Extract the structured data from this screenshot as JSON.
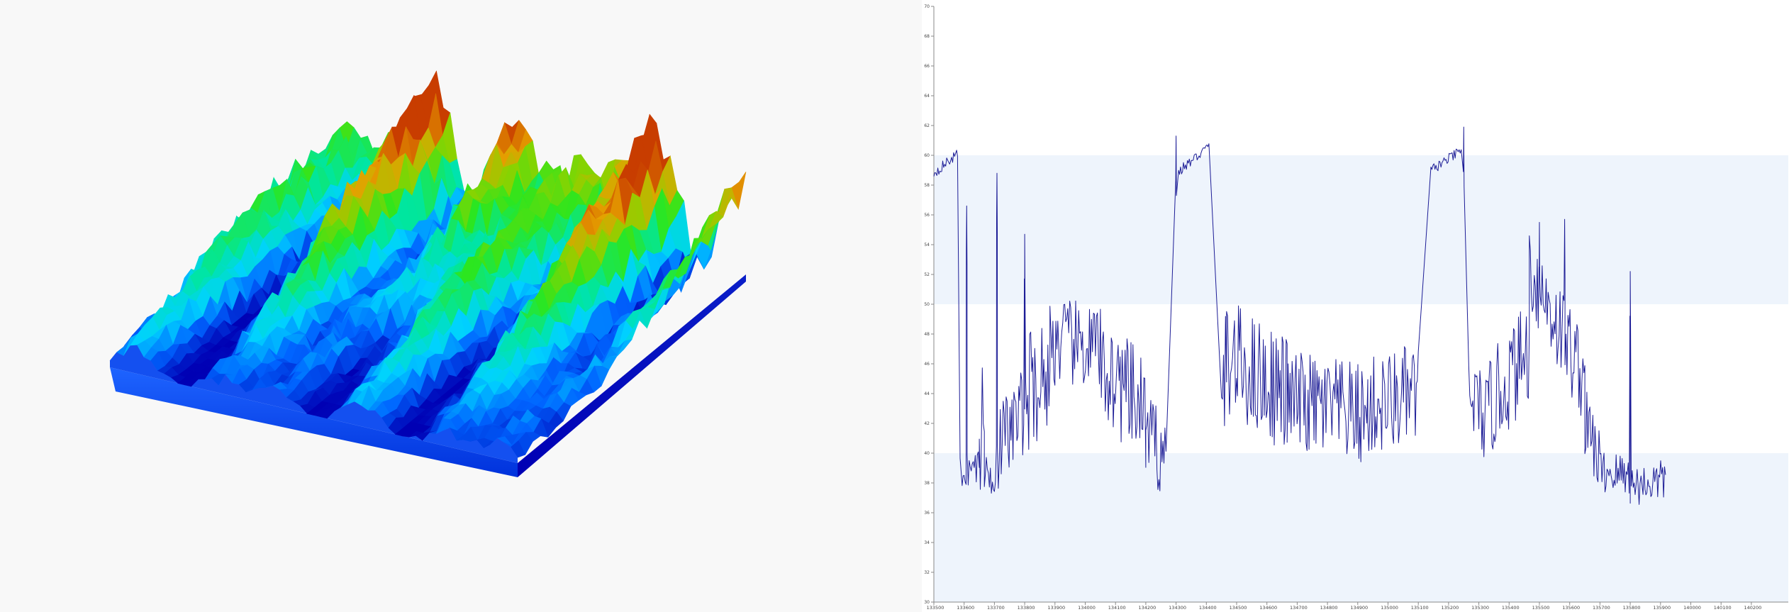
{
  "chart_data": [
    {
      "type": "surface",
      "colormap": [
        "#0000b4",
        "#0064ff",
        "#00d2ff",
        "#00e6a0",
        "#2ce61e",
        "#8cd200",
        "#e6a000",
        "#c83c00"
      ]
    },
    {
      "type": "line",
      "x_tick_labels": [
        "133500",
        "133600",
        "133700",
        "133800",
        "133900",
        "134000",
        "134100",
        "134200",
        "134300",
        "134400",
        "134500",
        "134600",
        "134700",
        "134800",
        "134900",
        "135000",
        "135100",
        "135200",
        "135300",
        "135400",
        "135500",
        "135600",
        "135700",
        "135800",
        "135900",
        "140000",
        "140100",
        "140200"
      ],
      "y_tick_labels": [
        "30",
        "32",
        "34",
        "36",
        "38",
        "40",
        "42",
        "44",
        "46",
        "48",
        "50",
        "52",
        "54",
        "56",
        "58",
        "60",
        "62",
        "64",
        "66",
        "68",
        "70"
      ],
      "ylim": [
        30,
        70
      ],
      "bands": [
        [
          30,
          40
        ],
        [
          50,
          60
        ]
      ],
      "band_color": "#eef4fc",
      "line_color": "#1c1c96",
      "segments": [
        {
          "x": [
            133500,
            133547
          ],
          "y": [
            58.8,
            60.1
          ],
          "noise": 0.35
        },
        {
          "x": [
            133552,
            133590
          ],
          "y": [
            38.7,
            39.2
          ],
          "noise": 1.2
        },
        {
          "x": [
            133590,
            133640
          ],
          "y": [
            40.0,
            44.0
          ],
          "noise": 3.5
        },
        {
          "x": [
            133640,
            133700
          ],
          "y": [
            38.5,
            38.5
          ],
          "noise": 1.5
        },
        {
          "x": [
            133700,
            133760
          ],
          "y": [
            40.0,
            43.0
          ],
          "noise": 3.0
        },
        {
          "x": [
            133760,
            133850
          ],
          "y": [
            44.0,
            45.5
          ],
          "noise": 4.0
        },
        {
          "x": [
            133850,
            133990
          ],
          "y": [
            47.5,
            47.0
          ],
          "noise": 3.0
        },
        {
          "x": [
            133990,
            134160
          ],
          "y": [
            46.0,
            42.5
          ],
          "noise": 3.8
        },
        {
          "x": [
            134160,
            134240
          ],
          "y": [
            41.0,
            40.0
          ],
          "noise": 3.0
        },
        {
          "x": [
            134265,
            134365
          ],
          "y": [
            58.9,
            60.6
          ],
          "noise": 0.35
        },
        {
          "x": [
            134390,
            134440
          ],
          "y": [
            45.0,
            45.5
          ],
          "noise": 4.0
        },
        {
          "x": [
            134440,
            134640
          ],
          "y": [
            46.5,
            44.0
          ],
          "noise": 4.0
        },
        {
          "x": [
            134640,
            134920
          ],
          "y": [
            43.5,
            42.5
          ],
          "noise": 3.5
        },
        {
          "x": [
            134920,
            135100
          ],
          "y": [
            43.0,
            44.0
          ],
          "noise": 3.5
        },
        {
          "x": [
            135125,
            135225
          ],
          "y": [
            59.0,
            60.3
          ],
          "noise": 0.35
        },
        {
          "x": [
            135240,
            135320
          ],
          "y": [
            44.0,
            42.0
          ],
          "noise": 3.0
        },
        {
          "x": [
            135320,
            135440
          ],
          "y": [
            43.0,
            47.0
          ],
          "noise": 3.5
        },
        {
          "x": [
            135440,
            135590
          ],
          "y": [
            52.5,
            45.0
          ],
          "noise": 3.2
        },
        {
          "x": [
            135590,
            135700
          ],
          "y": [
            42.0,
            39.5
          ],
          "noise": 2.5
        },
        {
          "x": [
            135700,
            135800
          ],
          "y": [
            38.8,
            38.5
          ],
          "noise": 1.5
        },
        {
          "x": [
            135800,
            135870
          ],
          "y": [
            37.8,
            38.2
          ],
          "noise": 1.4
        }
      ],
      "spikes": [
        {
          "x": 133605,
          "y": 56.6
        },
        {
          "x": 133705,
          "y": 58.8
        },
        {
          "x": 133800,
          "y": 54.7
        },
        {
          "x": 134300,
          "y": 61.3
        },
        {
          "x": 135230,
          "y": 61.9
        },
        {
          "x": 135500,
          "y": 55.5
        },
        {
          "x": 135550,
          "y": 55.7
        },
        {
          "x": 135800,
          "y": 52.2
        }
      ]
    }
  ]
}
